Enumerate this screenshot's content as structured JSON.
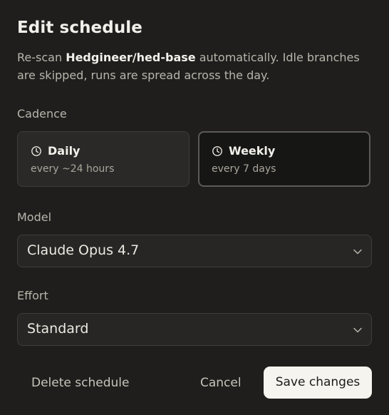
{
  "dialog": {
    "title": "Edit schedule",
    "description": {
      "prefix": "Re-scan ",
      "repo": "Hedgineer/hed-base",
      "suffix": " automatically. Idle branches are skipped, runs are spread across the day."
    }
  },
  "cadence": {
    "label": "Cadence",
    "selected": "Weekly",
    "options": [
      {
        "name": "Daily",
        "detail": "every ~24 hours",
        "icon": "clock-icon"
      },
      {
        "name": "Weekly",
        "detail": "every 7 days",
        "icon": "clock-icon"
      }
    ]
  },
  "model": {
    "label": "Model",
    "value": "Claude Opus 4.7"
  },
  "effort": {
    "label": "Effort",
    "value": "Standard"
  },
  "actions": {
    "delete_label": "Delete schedule",
    "cancel_label": "Cancel",
    "save_label": "Save changes"
  },
  "colors": {
    "background": "#1f1e1d",
    "primary_button": "#f6f4ee",
    "selected_card": "#161615"
  }
}
